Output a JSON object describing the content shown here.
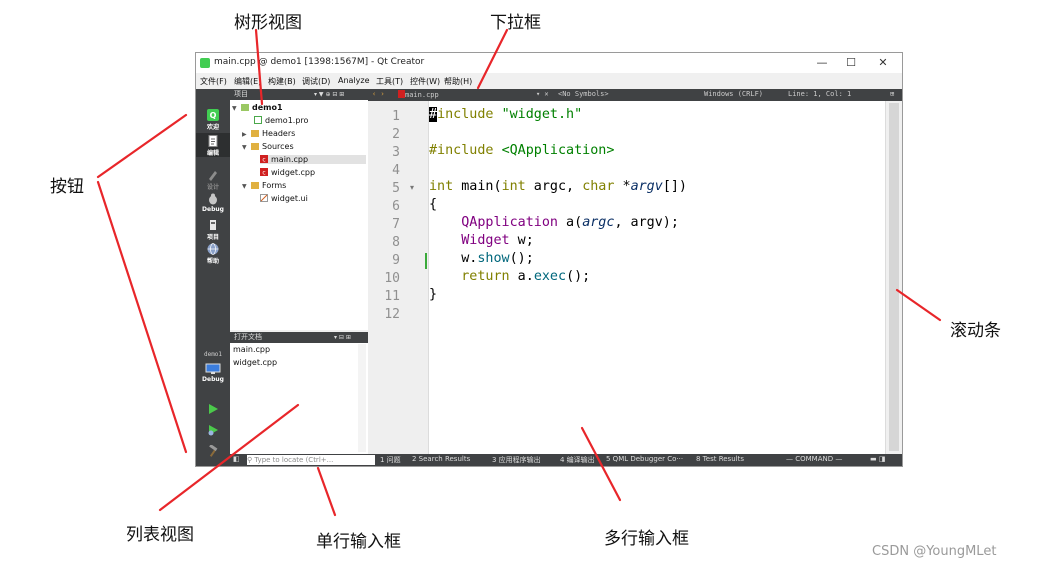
{
  "window": {
    "title": "main.cpp @ demo1 [1398:1567M] - Qt Creator",
    "controls": [
      "—",
      "☐",
      "✕"
    ],
    "menus": [
      "文件(F)",
      "编辑(E)",
      "构建(B)",
      "调试(D)",
      "Analyze",
      "工具(T)",
      "控件(W)",
      "帮助(H)"
    ]
  },
  "modes": [
    {
      "label": "欢迎",
      "icon": "qt-logo-icon"
    },
    {
      "label": "编辑",
      "icon": "document-edit-icon"
    },
    {
      "label": "设计",
      "icon": "design-pen-icon"
    },
    {
      "label": "Debug",
      "icon": "debug-bug-icon"
    },
    {
      "label": "项目",
      "icon": "project-wrench-icon"
    },
    {
      "label": "帮助",
      "icon": "help-globe-icon"
    }
  ],
  "run_controls": {
    "kit_label": "demo1",
    "build_label": "Debug"
  },
  "project_panel": {
    "title": "项目",
    "items": [
      {
        "label": "demo1",
        "bold": true
      },
      {
        "label": "demo1.pro"
      },
      {
        "label": "Headers"
      },
      {
        "label": "Sources"
      },
      {
        "label": "main.cpp",
        "selected": true
      },
      {
        "label": "widget.cpp"
      },
      {
        "label": "Forms"
      },
      {
        "label": "widget.ui"
      }
    ]
  },
  "open_docs": {
    "title": "打开文档",
    "items": [
      "main.cpp",
      "widget.cpp"
    ]
  },
  "editor": {
    "tab": "main.cpp",
    "symbols": "<No Symbols>",
    "encoding": "Windows (CRLF)",
    "position": "Line: 1, Col: 1",
    "line_numbers": [
      "1",
      "2",
      "3",
      "4",
      "5",
      "6",
      "7",
      "8",
      "9",
      "10",
      "11",
      "12"
    ]
  },
  "statusbar": {
    "locator_placeholder": "Type to locate (Ctrl+...",
    "panes": [
      "1 问题",
      "2 Search Results",
      "3 应用程序输出",
      "4 编译输出",
      "5 QML Debugger Co···",
      "8 Test Results"
    ],
    "mode": "— COMMAND —"
  },
  "callouts": {
    "tree_view": "树形视图",
    "dropdown": "下拉框",
    "button": "按钮",
    "scrollbar": "滚动条",
    "list_view": "列表视图",
    "line_edit": "单行输入框",
    "text_edit": "多行输入框"
  },
  "watermark": "CSDN @YoungMLet",
  "colors": {
    "annotation": "#e8262a",
    "dark_bar": "#404244",
    "qt_green": "#41cd52"
  }
}
